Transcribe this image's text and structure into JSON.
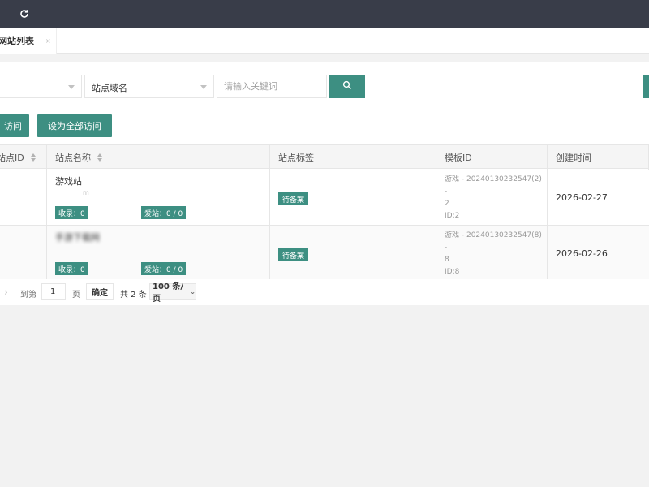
{
  "tabs": [
    {
      "label": "网站列表",
      "close": "×"
    }
  ],
  "filters": {
    "select1_value": "",
    "select2_value": "站点域名",
    "keyword_placeholder": "请输入关键词"
  },
  "actions": {
    "btn1_label": "访问",
    "btn2_label": "设为全部访问"
  },
  "table": {
    "headers": [
      "站点ID",
      "站点名称",
      "站点标签",
      "模板ID",
      "创建时间"
    ],
    "rows": [
      {
        "name": "游戏站",
        "domain": "m",
        "badge_collect": "收录：0",
        "badge_love": "爱站：0 / 0",
        "tag": "待备案",
        "template_line1": "游戏 - 20240130232547(2) -",
        "template_line2": "2",
        "template_id": "ID:2",
        "created": "2026-02-27"
      },
      {
        "name": "手游下载网",
        "domain": "",
        "badge_collect": "收录：0",
        "badge_love": "爱站：0 / 0",
        "tag": "待备案",
        "template_line1": "游戏 - 20240130232547(8) -",
        "template_line2": "8",
        "template_id": "ID:8",
        "created": "2026-02-26"
      }
    ]
  },
  "pager": {
    "prev_arrow": "›",
    "goto_label": "到第",
    "page_value": "1",
    "page_unit": "页",
    "confirm_label": "确定",
    "total_label": "共 2 条",
    "page_size_label": "100 条/页"
  },
  "colors": {
    "topbar": "#393d49",
    "accent": "#3d8f82"
  }
}
